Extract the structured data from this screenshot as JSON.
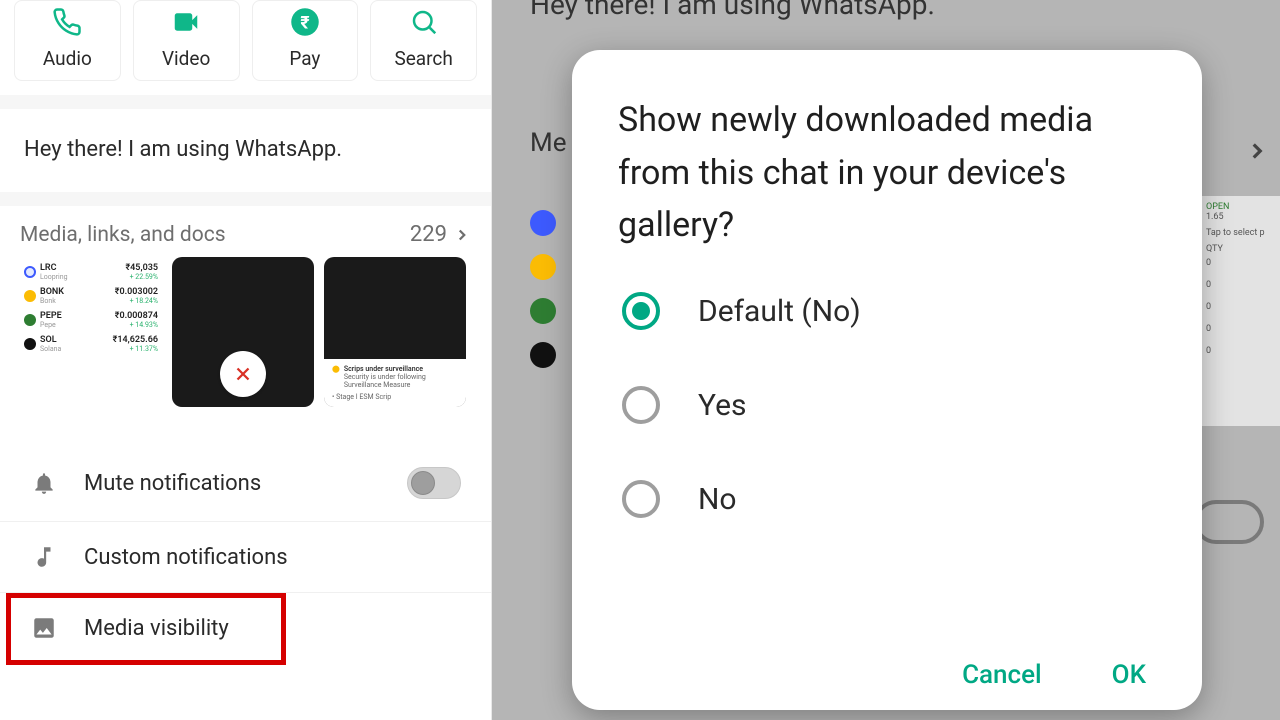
{
  "actions": {
    "audio": "Audio",
    "video": "Video",
    "pay": "Pay",
    "search": "Search"
  },
  "about_text": "Hey there! I am using WhatsApp.",
  "media_header": {
    "title": "Media, links, and docs",
    "count": "229"
  },
  "thumbs": {
    "coins": [
      {
        "name": "LRC",
        "sub": "Loopring",
        "amount": "₹45,035",
        "change": "+ 22.59%",
        "color": "#3d5afe"
      },
      {
        "name": "BONK",
        "sub": "Bonk",
        "amount": "₹0.003002",
        "change": "+ 18.24%",
        "color": "#fbbc04"
      },
      {
        "name": "PEPE",
        "sub": "Pepe",
        "amount": "₹0.000874",
        "change": "+ 14.93%",
        "color": "#2e7d32"
      },
      {
        "name": "SOL",
        "sub": "Solana",
        "amount": "₹14,625.66",
        "change": "+ 11.37%",
        "color": "#111"
      }
    ],
    "surveillance_title": "Scrips under surveillance",
    "surveillance_sub": "Security is under following Surveillance Measure",
    "surveillance_stage": "• Stage I ESM Scrip",
    "partial": {
      "open": "OPEN",
      "val": "1.65",
      "tap": "Tap to select p",
      "qty": "QTY",
      "zeros": [
        "0",
        "0",
        "0",
        "0",
        "0"
      ]
    }
  },
  "settings": {
    "mute": "Mute notifications",
    "custom": "Custom notifications",
    "media_vis": "Media visibility"
  },
  "right_bg": {
    "about_partial": "Hey there! I am using WhatsApp.",
    "media_partial": "Me"
  },
  "dialog": {
    "title": "Show newly downloaded media from this chat in your device's gallery?",
    "opt_default": "Default (No)",
    "opt_yes": "Yes",
    "opt_no": "No",
    "cancel": "Cancel",
    "ok": "OK"
  }
}
